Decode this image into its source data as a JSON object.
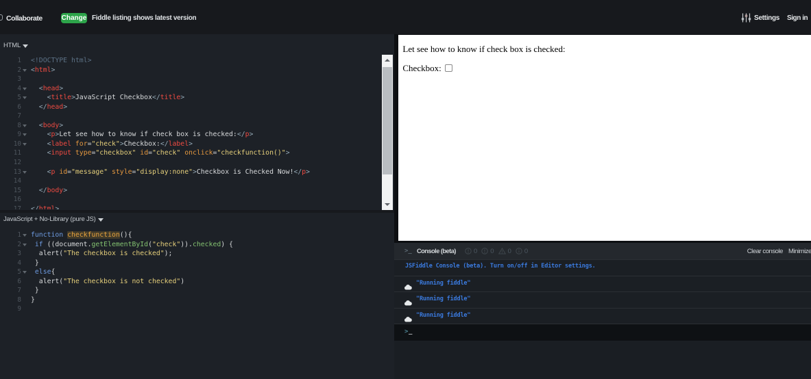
{
  "topbar": {
    "collaborate_label": "Collaborate",
    "change_button_label": "Change",
    "notice": "Fiddle listing shows latest version",
    "settings_label": "Settings",
    "sign_in_label": "Sign in",
    "change_button_color": "#2da44a"
  },
  "panels": {
    "html": {
      "title": "HTML",
      "lines": [
        {
          "n": 1,
          "fold": false,
          "seg": [
            [
              "<!DOCTYPE html>",
              "meta"
            ]
          ]
        },
        {
          "n": 2,
          "fold": true,
          "seg": [
            [
              "<",
              "br"
            ],
            [
              "html",
              "tag"
            ],
            [
              ">",
              "br"
            ]
          ]
        },
        {
          "n": 3,
          "fold": false,
          "seg": []
        },
        {
          "n": 4,
          "fold": true,
          "seg": [
            [
              "  ",
              "txt"
            ],
            [
              "<",
              "br"
            ],
            [
              "head",
              "tag"
            ],
            [
              ">",
              "br"
            ]
          ]
        },
        {
          "n": 5,
          "fold": true,
          "seg": [
            [
              "    ",
              "txt"
            ],
            [
              "<",
              "br"
            ],
            [
              "title",
              "tag"
            ],
            [
              ">",
              "br"
            ],
            [
              "JavaScript Checkbox",
              "txt"
            ],
            [
              "</",
              "br"
            ],
            [
              "title",
              "tag"
            ],
            [
              ">",
              "br"
            ]
          ]
        },
        {
          "n": 6,
          "fold": false,
          "seg": [
            [
              "  ",
              "txt"
            ],
            [
              "</",
              "br"
            ],
            [
              "head",
              "tag"
            ],
            [
              ">",
              "br"
            ]
          ]
        },
        {
          "n": 7,
          "fold": false,
          "seg": []
        },
        {
          "n": 8,
          "fold": true,
          "seg": [
            [
              "  ",
              "txt"
            ],
            [
              "<",
              "br"
            ],
            [
              "body",
              "tag"
            ],
            [
              ">",
              "br"
            ]
          ]
        },
        {
          "n": 9,
          "fold": true,
          "seg": [
            [
              "    ",
              "txt"
            ],
            [
              "<",
              "br"
            ],
            [
              "p",
              "tag"
            ],
            [
              ">",
              "br"
            ],
            [
              "Let see how to know if check box is checked:",
              "txt"
            ],
            [
              "</",
              "br"
            ],
            [
              "p",
              "tag"
            ],
            [
              ">",
              "br"
            ]
          ]
        },
        {
          "n": 10,
          "fold": true,
          "seg": [
            [
              "    ",
              "txt"
            ],
            [
              "<",
              "br"
            ],
            [
              "label",
              "tag"
            ],
            [
              " ",
              "txt"
            ],
            [
              "for",
              "attr"
            ],
            [
              "=",
              "txt"
            ],
            [
              "\"check\"",
              "str"
            ],
            [
              ">",
              "br"
            ],
            [
              "Checkbox:",
              "txt"
            ],
            [
              "</",
              "br"
            ],
            [
              "label",
              "tag"
            ],
            [
              ">",
              "br"
            ]
          ]
        },
        {
          "n": 11,
          "fold": false,
          "seg": [
            [
              "    ",
              "txt"
            ],
            [
              "<",
              "br"
            ],
            [
              "input",
              "tag"
            ],
            [
              " ",
              "txt"
            ],
            [
              "type",
              "attr"
            ],
            [
              "=",
              "txt"
            ],
            [
              "\"checkbox\"",
              "str"
            ],
            [
              " ",
              "txt"
            ],
            [
              "id",
              "attr"
            ],
            [
              "=",
              "txt"
            ],
            [
              "\"check\"",
              "str"
            ],
            [
              " ",
              "txt"
            ],
            [
              "onclick",
              "attr"
            ],
            [
              "=",
              "txt"
            ],
            [
              "\"checkfunction()\"",
              "str"
            ],
            [
              ">",
              "br"
            ]
          ]
        },
        {
          "n": 12,
          "fold": false,
          "seg": []
        },
        {
          "n": 13,
          "fold": true,
          "seg": [
            [
              "    ",
              "txt"
            ],
            [
              "<",
              "br"
            ],
            [
              "p",
              "tag"
            ],
            [
              " ",
              "txt"
            ],
            [
              "id",
              "attr"
            ],
            [
              "=",
              "txt"
            ],
            [
              "\"message\"",
              "str"
            ],
            [
              " ",
              "txt"
            ],
            [
              "style",
              "attr"
            ],
            [
              "=",
              "txt"
            ],
            [
              "\"display:none\"",
              "str"
            ],
            [
              ">",
              "br"
            ],
            [
              "Checkbox is Checked Now!",
              "txt"
            ],
            [
              "</",
              "br"
            ],
            [
              "p",
              "tag"
            ],
            [
              ">",
              "br"
            ]
          ]
        },
        {
          "n": 14,
          "fold": false,
          "seg": []
        },
        {
          "n": 15,
          "fold": false,
          "seg": [
            [
              "  ",
              "txt"
            ],
            [
              "</",
              "br"
            ],
            [
              "body",
              "tag"
            ],
            [
              ">",
              "br"
            ]
          ]
        },
        {
          "n": 16,
          "fold": false,
          "seg": []
        },
        {
          "n": 17,
          "fold": false,
          "seg": [
            [
              "</",
              "br"
            ],
            [
              "html",
              "tag"
            ],
            [
              ">",
              "br"
            ]
          ]
        }
      ]
    },
    "js": {
      "title": "JavaScript + No-Library (pure JS)",
      "lines": [
        {
          "n": 1,
          "fold": true,
          "seg": [
            [
              "function",
              "kw"
            ],
            [
              " ",
              "txt"
            ],
            [
              "checkfunction",
              "def"
            ],
            [
              "(){",
              "txt"
            ]
          ]
        },
        {
          "n": 2,
          "fold": true,
          "seg": [
            [
              " ",
              "txt"
            ],
            [
              "if",
              "kw"
            ],
            [
              " ((document.",
              "txt"
            ],
            [
              "getElementById",
              "prop"
            ],
            [
              "(",
              "txt"
            ],
            [
              "\"check\"",
              "str"
            ],
            [
              ")).",
              "txt"
            ],
            [
              "checked",
              "prop"
            ],
            [
              ") {",
              "txt"
            ]
          ]
        },
        {
          "n": 3,
          "fold": false,
          "seg": [
            [
              "  alert(",
              "txt"
            ],
            [
              "\"The checkbox is checked\"",
              "str"
            ],
            [
              ");",
              "txt"
            ]
          ]
        },
        {
          "n": 4,
          "fold": false,
          "seg": [
            [
              " }",
              "txt"
            ]
          ]
        },
        {
          "n": 5,
          "fold": true,
          "seg": [
            [
              " ",
              "txt"
            ],
            [
              "else",
              "kw"
            ],
            [
              "{",
              "txt"
            ]
          ]
        },
        {
          "n": 6,
          "fold": false,
          "seg": [
            [
              "  alert(",
              "txt"
            ],
            [
              "\"The checkbox is not checked\"",
              "str"
            ],
            [
              ")",
              "txt"
            ]
          ]
        },
        {
          "n": 7,
          "fold": false,
          "seg": [
            [
              " }",
              "txt"
            ]
          ]
        },
        {
          "n": 8,
          "fold": false,
          "seg": [
            [
              "}",
              "txt"
            ]
          ]
        },
        {
          "n": 9,
          "fold": false,
          "seg": []
        }
      ]
    }
  },
  "result": {
    "intro_text": "Let see how to know if check box is checked:",
    "checkbox_label": "Checkbox:",
    "checkbox_checked": false
  },
  "console": {
    "title": "Console (beta)",
    "prompt_icon": ">_",
    "counters": [
      {
        "icon": "error-circle-icon",
        "count": "0"
      },
      {
        "icon": "exclamation-circle-icon",
        "count": "0"
      },
      {
        "icon": "warning-triangle-icon",
        "count": "0"
      },
      {
        "icon": "info-circle-icon",
        "count": "0"
      }
    ],
    "clear_label": "Clear console",
    "minimize_label": "Minimize",
    "info_message": "JSFiddle Console (beta). Turn on/off in Editor settings.",
    "logs": [
      "\"Running fiddle\"",
      "\"Running fiddle\"",
      "\"Running fiddle\""
    ],
    "prompt_gt": ">",
    "prompt_underscore": "_"
  }
}
